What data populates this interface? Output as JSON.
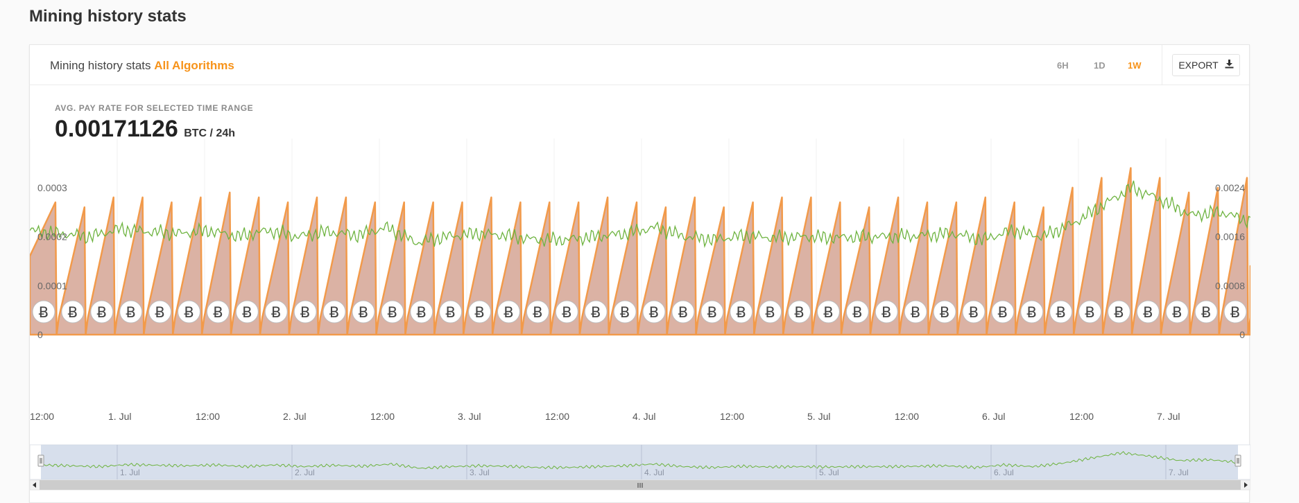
{
  "page": {
    "heading": "Mining history stats"
  },
  "card": {
    "title_prefix": "Mining history stats",
    "title_accent": "All Algorithms",
    "ranges": [
      {
        "label": "6H",
        "active": false
      },
      {
        "label": "1D",
        "active": false
      },
      {
        "label": "1W",
        "active": true
      }
    ],
    "export_label": "EXPORT"
  },
  "stat": {
    "label": "AVG. PAY RATE FOR SELECTED TIME RANGE",
    "value": "0.00171126",
    "unit": "BTC / 24h"
  },
  "colors": {
    "accent": "#f7931a",
    "unpaid_fill": "#dbb2a4",
    "unpaid_line": "#f29a4a",
    "profit_line": "#6db33f",
    "navigator_fill": "#c9d4e6"
  },
  "icons": {
    "payout_marker": "bitcoin-icon",
    "export": "download-icon"
  },
  "chart_data": {
    "type": "line",
    "x_tick_labels": [
      "12:00",
      "1. Jul",
      "12:00",
      "2. Jul",
      "12:00",
      "3. Jul",
      "12:00",
      "4. Jul",
      "12:00",
      "5. Jul",
      "12:00",
      "6. Jul",
      "12:00",
      "7. Jul"
    ],
    "left_axis": {
      "ticks": [
        "0",
        "0.0001",
        "0.0002",
        "0.0003"
      ],
      "range": [
        0,
        0.0004
      ]
    },
    "right_axis": {
      "ticks": [
        "0",
        "0.0008",
        "0.0016",
        "0.0024"
      ],
      "range": [
        0,
        0.0032
      ]
    },
    "payout_count": 42,
    "payout_marker_glyph": "Ƀ",
    "series": [
      {
        "axis": "left",
        "values": [
          0.00027,
          0.00026,
          0.00028,
          0.00028,
          0.00027,
          0.00028,
          0.00029,
          0.00028,
          0.00027,
          0.00028,
          0.00028,
          0.00027,
          0.00027,
          0.00027,
          0.00027,
          0.00028,
          0.00027,
          0.00027,
          0.00027,
          0.00028,
          0.00027,
          0.00026,
          0.00028,
          0.00026,
          0.00027,
          0.00028,
          0.00028,
          0.00027,
          0.00026,
          0.00028,
          0.00027,
          0.00027,
          0.00028,
          0.00027,
          0.00026,
          0.0003,
          0.00032,
          0.00034,
          0.00032,
          0.00029,
          0.0003,
          0.00032
        ]
      },
      {
        "axis": "right",
        "values": [
          0.0017,
          0.00165,
          0.0016,
          0.00172,
          0.00168,
          0.00165,
          0.0017,
          0.0016,
          0.0017,
          0.0016,
          0.00168,
          0.00162,
          0.00175,
          0.0015,
          0.0016,
          0.00165,
          0.00162,
          0.00155,
          0.00155,
          0.0016,
          0.00165,
          0.00175,
          0.0016,
          0.00155,
          0.00162,
          0.00158,
          0.0016,
          0.00158,
          0.0016,
          0.0016,
          0.00162,
          0.00165,
          0.00155,
          0.0017,
          0.0016,
          0.0018,
          0.0021,
          0.0024,
          0.0022,
          0.00195,
          0.002,
          0.00185
        ]
      }
    ]
  }
}
